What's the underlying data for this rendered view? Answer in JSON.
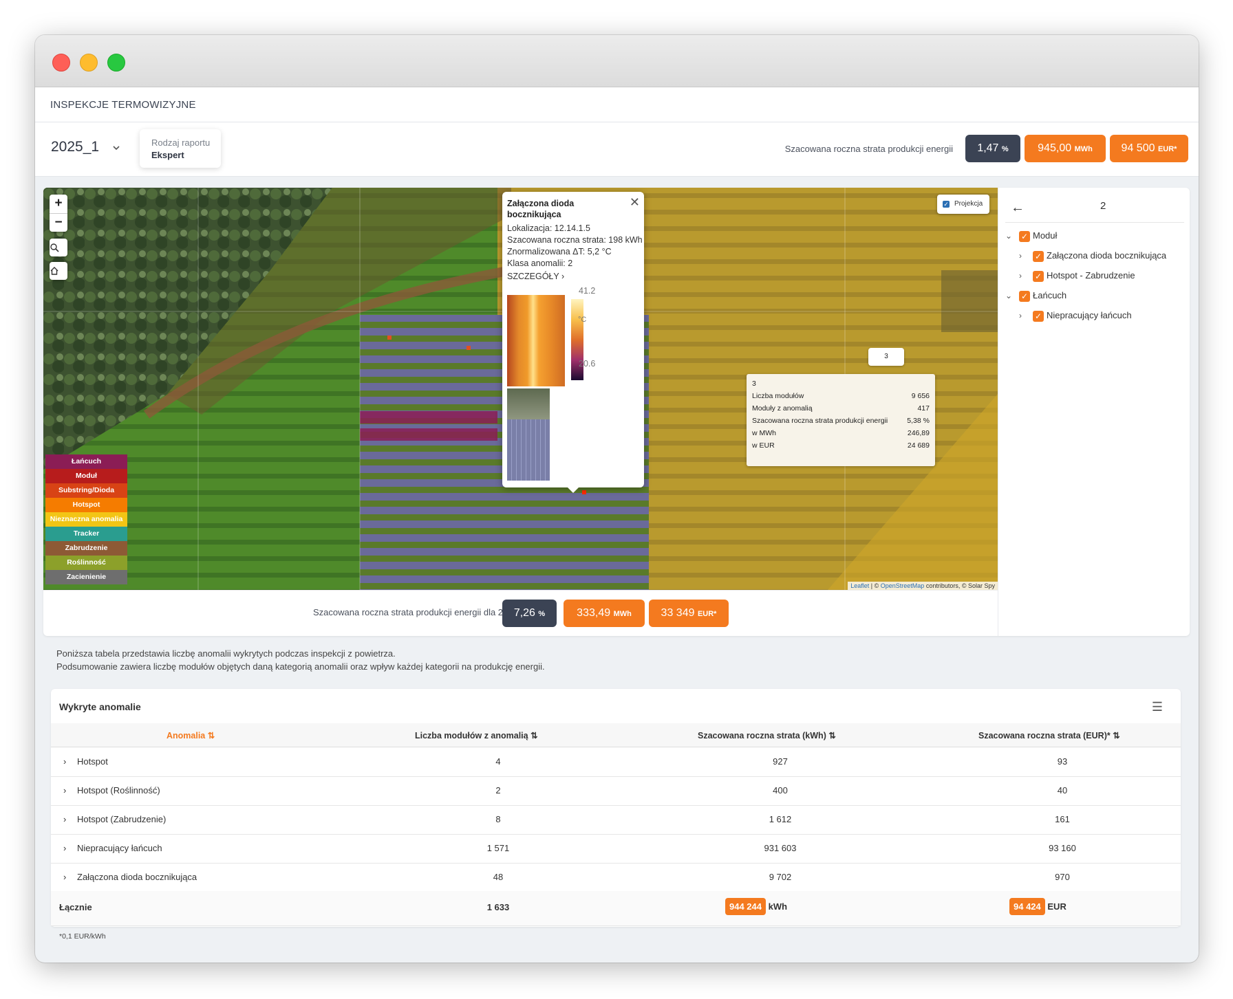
{
  "app": {
    "title": "INSPEKCJE TERMOWIZYJNE"
  },
  "toolbar": {
    "period": "2025_1",
    "report_type_label": "Rodzaj raportu",
    "report_type_value": "Ekspert",
    "loss_label": "Szacowana roczna strata produkcji energii",
    "loss_percent": "1,47",
    "loss_percent_unit": "%",
    "loss_mwh": "945,00",
    "loss_mwh_unit": "MWh",
    "loss_eur": "94 500",
    "loss_eur_unit": "EUR*"
  },
  "map": {
    "zoom_in": "+",
    "zoom_out": "−",
    "projection_label": "Projekcja",
    "legend": [
      {
        "label": "Łańcuch",
        "color": "#8b1d55"
      },
      {
        "label": "Moduł",
        "color": "#b71c1c"
      },
      {
        "label": "Substring/Dioda",
        "color": "#d84315"
      },
      {
        "label": "Hotspot",
        "color": "#f57c00"
      },
      {
        "label": "Nieznaczna anomalia",
        "color": "#f3c515"
      },
      {
        "label": "Tracker",
        "color": "#2a9d8f"
      },
      {
        "label": "Zabrudzenie",
        "color": "#8d5a35"
      },
      {
        "label": "Roślinność",
        "color": "#8ca02a"
      },
      {
        "label": "Zacienienie",
        "color": "#6e6e6e"
      }
    ],
    "popup": {
      "title": "Załączona dioda bocznikująca",
      "location": "Lokalizacja: 12.14.1.5",
      "est_loss": "Szacowana roczna strata: 198 kWh",
      "delta_t": "Znormalizowana ΔT: 5,2 °C",
      "anomaly_class": "Klasa anomalii: 2",
      "details": "SZCZEGÓŁY",
      "temp_max": "41.2",
      "temp_unit": "°C",
      "temp_min": "20.6"
    },
    "marker_label": "3",
    "tooltip": {
      "title": "3",
      "rows": [
        {
          "label": "Liczba modułów",
          "value": "9 656"
        },
        {
          "label": "Moduły z anomalią",
          "value": "417"
        },
        {
          "label": "Szacowana roczna strata produkcji energii",
          "value": "5,38 %"
        },
        {
          "label": "w MWh",
          "value": "246,89"
        },
        {
          "label": "w EUR",
          "value": "24 689"
        }
      ]
    },
    "attribution_leaflet": "Leaflet",
    "attribution_sep": " | © ",
    "attribution_osm": "OpenStreetMap",
    "attribution_rest": " contributors, © Solar Spy"
  },
  "block_loss": {
    "label": "Szacowana roczna strata produkcji energii dla 2",
    "percent": "7,26",
    "percent_unit": "%",
    "mwh": "333,49",
    "mwh_unit": "MWh",
    "eur": "33 349",
    "eur_unit": "EUR*"
  },
  "side_panel": {
    "back_icon": "arrow-left-icon",
    "selected": "2",
    "tree": [
      {
        "label": "Moduł",
        "level": 0,
        "expanded": true
      },
      {
        "label": "Załączona dioda bocznikująca",
        "level": 1,
        "expanded": false
      },
      {
        "label": "Hotspot - Zabrudzenie",
        "level": 1,
        "expanded": false
      },
      {
        "label": "Łańcuch",
        "level": 0,
        "expanded": true
      },
      {
        "label": "Niepracujący łańcuch",
        "level": 1,
        "expanded": false
      }
    ]
  },
  "intro": {
    "line1": "Poniższa tabela przedstawia liczbę anomalii wykrytych podczas inspekcji z powietrza.",
    "line2": "Podsumowanie zawiera liczbę modułów objętych daną kategorią anomalii oraz wpływ każdej kategorii na produkcję energii."
  },
  "table": {
    "title": "Wykryte anomalie",
    "headers": [
      "Anomalia",
      "Liczba modułów z anomalią",
      "Szacowana roczna strata (kWh)",
      "Szacowana roczna strata (EUR)*"
    ],
    "rows": [
      [
        "Hotspot",
        "4",
        "927",
        "93"
      ],
      [
        "Hotspot (Roślinność)",
        "2",
        "400",
        "40"
      ],
      [
        "Hotspot (Zabrudzenie)",
        "8",
        "1 612",
        "161"
      ],
      [
        "Niepracujący łańcuch",
        "1 571",
        "931 603",
        "93 160"
      ],
      [
        "Załączona dioda bocznikująca",
        "48",
        "9 702",
        "970"
      ]
    ],
    "total_label": "Łącznie",
    "total_modules": "1 633",
    "total_kwh": "944 244",
    "total_kwh_unit": "kWh",
    "total_eur": "94 424",
    "total_eur_unit": "EUR",
    "footnote": "*0,1 EUR/kWh"
  },
  "colors": {
    "accent": "#f47a1f",
    "dark_badge": "#3b4354"
  }
}
